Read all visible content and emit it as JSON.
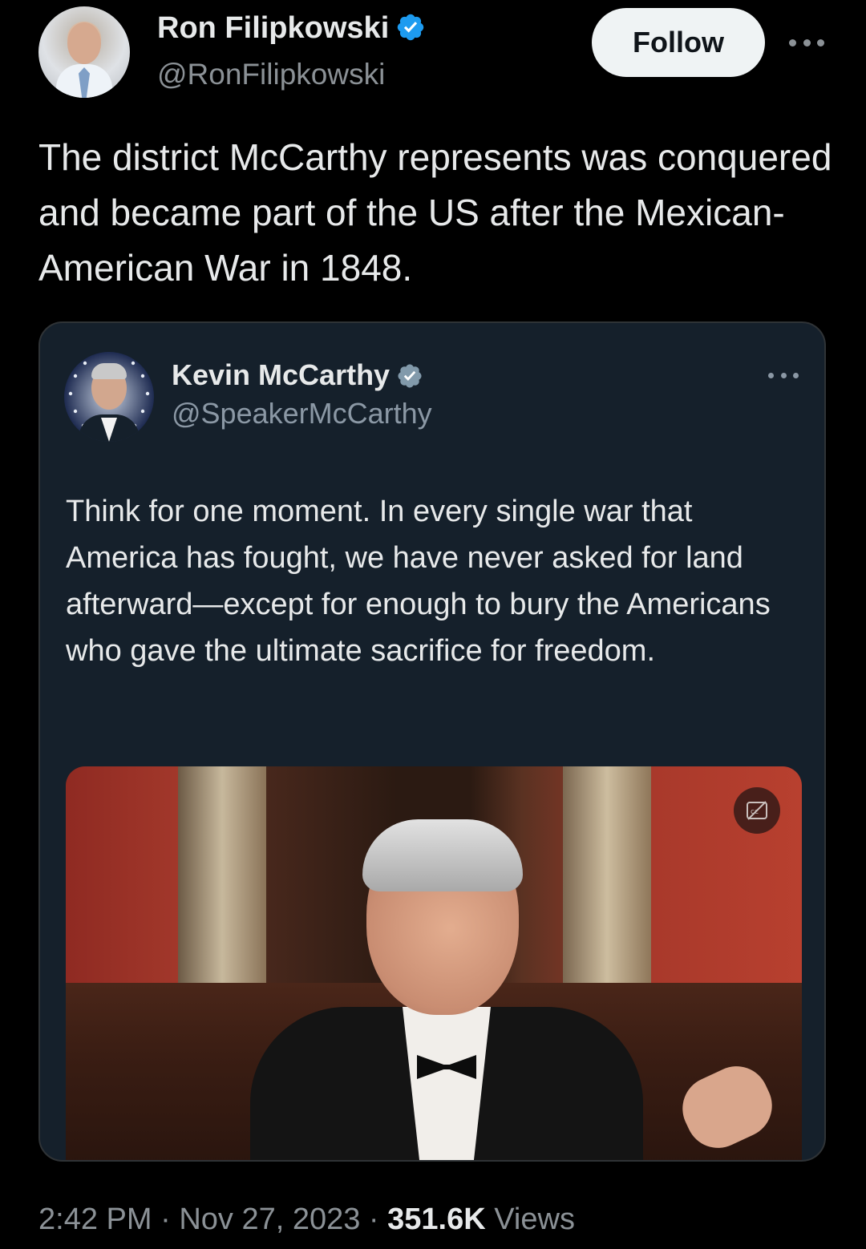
{
  "author": {
    "display_name": "Ron Filipkowski",
    "handle": "@RonFilipkowski",
    "verified": true
  },
  "follow_label": "Follow",
  "tweet_text": "The district McCarthy represents was conquered and became part of the US after the Mexican-American War in 1848.",
  "quoted_tweet": {
    "display_name": "Kevin McCarthy",
    "handle": "@SpeakerMcCarthy",
    "verified": true,
    "text": "Think for one moment. In every single war that America has fought, we have never asked for land afterward—except for enough to bury the Americans who gave the ultimate sacrifice for freedom.",
    "media_type": "video"
  },
  "footer": {
    "time": "2:42 PM",
    "separator": " · ",
    "date": "Nov 27, 2023",
    "views_count": "351.6K",
    "views_label": "Views"
  },
  "colors": {
    "background": "#000000",
    "verified_blue": "#1d9bf0",
    "verified_gray": "#829aab",
    "text_primary": "#e7e9ea",
    "text_secondary": "#8b9196",
    "quote_bg": "#15202b",
    "follow_bg": "#eff3f4"
  },
  "icons": {
    "more": "more-horizontal-icon",
    "verified": "verified-badge-icon",
    "captions": "closed-captions-icon"
  }
}
